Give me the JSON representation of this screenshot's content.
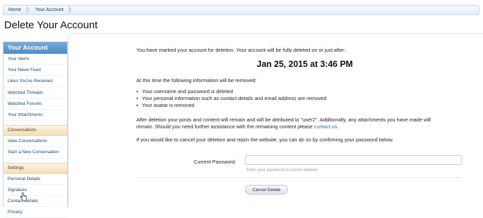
{
  "breadcrumb": {
    "items": [
      "Home",
      "Your Account"
    ]
  },
  "page_title": "Delete Your Account",
  "sidebar": {
    "header": "Your Account",
    "account_items": [
      "Your Alerts",
      "Your News Feed",
      "Likes You've Received",
      "Watched Threads",
      "Watched Forums",
      "Your Attachments"
    ],
    "conversations_header": "Conversations",
    "conversation_items": [
      "View Conversations",
      "Start a New Conversation"
    ],
    "settings_header": "Settings",
    "settings_items": [
      "Personal Details",
      "Signature",
      "Contact Details",
      "Privacy"
    ]
  },
  "main": {
    "notice": "You have marked your account for deletion. Your account will be fully deleted on or just after:",
    "deletion_date": "Jan 25, 2015 at 3:46 PM",
    "removed_intro": "At this time the following information will be removed:",
    "removed_items": [
      "Your username and password is deleted",
      "Your personal information such as contact details and email address are removed",
      "Your avatar is removed"
    ],
    "remain_line1": "After deletion your posts and content will remain and will be attributed to \"user2\". Additionally, any attachments you have made will",
    "remain_line2_a": "remain. Should you need further assistance with the remaining content please ",
    "contact_link": "contact us",
    "remain_line2_b": ".",
    "cancel_info": "If you would like to cancel your deletion and rejoin the website, you can do so by confirming your password below.",
    "password_label": "Current Password:",
    "password_value": "",
    "password_hint": "Enter your password to cancel deletion",
    "cancel_button": "Cancel Delete"
  }
}
